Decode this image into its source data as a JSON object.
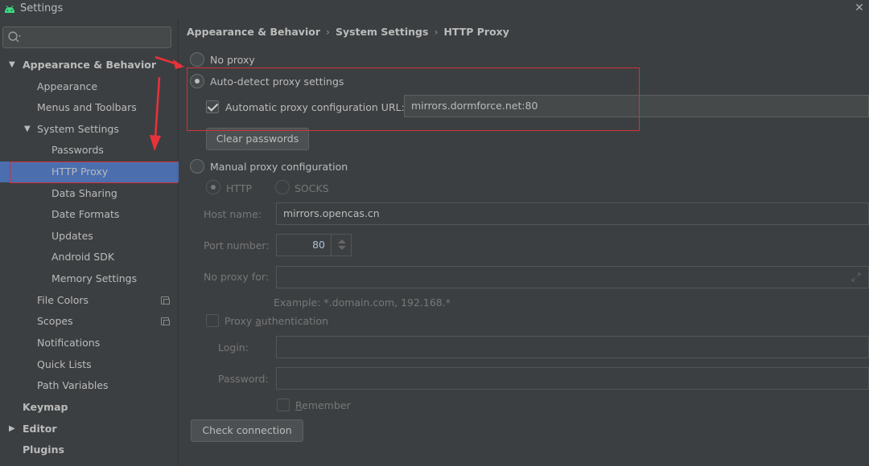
{
  "window": {
    "title": "Settings",
    "app_icon": "android-icon",
    "close_icon": "close-icon"
  },
  "sidebar": {
    "search": {
      "placeholder": "",
      "value": "",
      "icon": "search-icon"
    },
    "items": [
      {
        "label": "Appearance & Behavior",
        "level": 0,
        "bold": true,
        "expanded": true
      },
      {
        "label": "Appearance",
        "level": 1
      },
      {
        "label": "Menus and Toolbars",
        "level": 1
      },
      {
        "label": "System Settings",
        "level": 1,
        "expanded": true
      },
      {
        "label": "Passwords",
        "level": 2
      },
      {
        "label": "HTTP Proxy",
        "level": 2,
        "selected": true
      },
      {
        "label": "Data Sharing",
        "level": 2
      },
      {
        "label": "Date Formats",
        "level": 2
      },
      {
        "label": "Updates",
        "level": 2
      },
      {
        "label": "Android SDK",
        "level": 2
      },
      {
        "label": "Memory Settings",
        "level": 2
      },
      {
        "label": "File Colors",
        "level": 1,
        "project_icon": true
      },
      {
        "label": "Scopes",
        "level": 1,
        "project_icon": true
      },
      {
        "label": "Notifications",
        "level": 1
      },
      {
        "label": "Quick Lists",
        "level": 1
      },
      {
        "label": "Path Variables",
        "level": 1
      },
      {
        "label": "Keymap",
        "level": 0,
        "bold": true
      },
      {
        "label": "Editor",
        "level": 0,
        "bold": true,
        "expanded": false
      },
      {
        "label": "Plugins",
        "level": 0,
        "bold": true
      }
    ]
  },
  "breadcrumb": [
    "Appearance & Behavior",
    "System Settings",
    "HTTP Proxy"
  ],
  "proxy": {
    "no_proxy_label": "No proxy",
    "no_proxy_selected": false,
    "auto_detect_label": "Auto-detect proxy settings",
    "auto_detect_selected": true,
    "auto_config_url_label": "Automatic proxy configuration URL:",
    "auto_config_url_checked": true,
    "auto_config_url_value": "mirrors.dormforce.net:80",
    "clear_passwords_label": "Clear passwords",
    "manual_label": "Manual proxy configuration",
    "manual_selected": false,
    "http_label": "HTTP",
    "http_selected": true,
    "socks_label": "SOCKS",
    "socks_selected": false,
    "host_name_label": "Host name:",
    "host_name_value": "mirrors.opencas.cn",
    "port_number_label": "Port number:",
    "port_number_value": "80",
    "no_proxy_for_label": "No proxy for:",
    "no_proxy_for_value": "",
    "example_text": "Example: *.domain.com, 192.168.*",
    "proxy_auth_label_pre": "Proxy ",
    "proxy_auth_label_mnemonic": "a",
    "proxy_auth_label_post": "uthentication",
    "proxy_auth_checked": false,
    "login_label": "Login:",
    "login_value": "",
    "password_label": "Password:",
    "password_value": "",
    "remember_label_mnemonic": "R",
    "remember_label_post": "emember",
    "remember_checked": false,
    "check_connection_label": "Check connection"
  },
  "annotations": {
    "color": "#d0323c"
  }
}
